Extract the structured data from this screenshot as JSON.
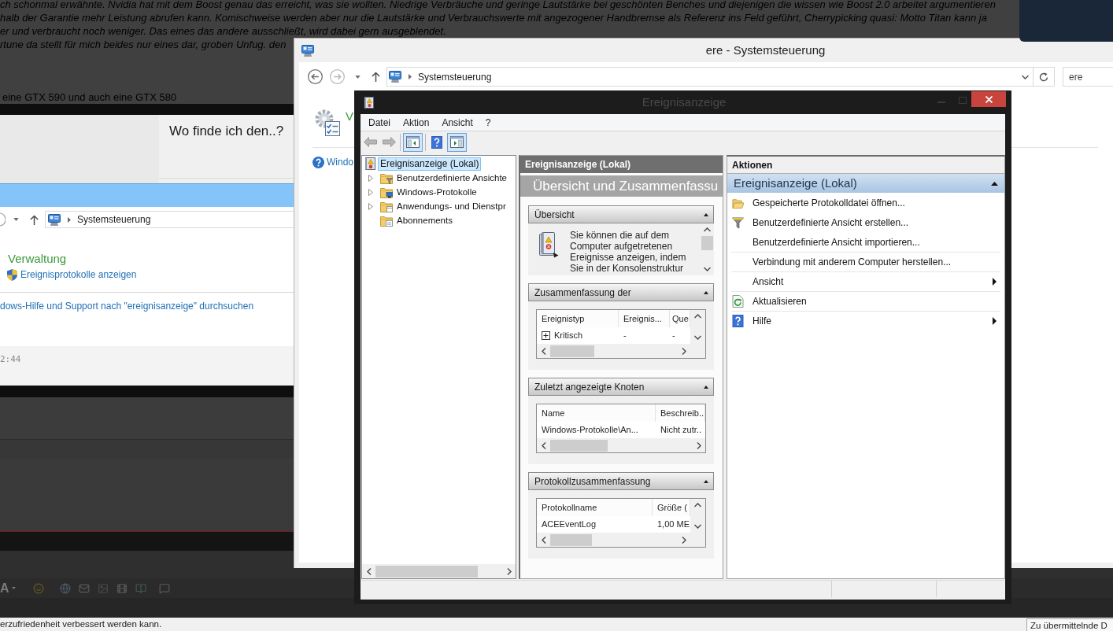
{
  "forum": {
    "post_lines": [
      "ch schonmal erwähnte. Nvidia hat mit dem Boost genau das erreicht, was sie wollten. Niedrige Verbräuche und geringe Lautstärke bei geschönten Benches und diejenigen die wissen wie Boost 2.0 arbeitet argumentieren",
      "halb der Garantie mehr Leistung abrufen kann. Komischweise werden aber nur die Lautstärke und Verbrauchswerte mit angezogener Handbremse als Referenz ins Feld geführt, Cherrypicking quasi: Motto Titan kann ja",
      "er und verbraucht noch weniger. Das eines das andere ausschließt, wird dabei gern ausgeblendet.",
      "rtune da stellt für mich beides nur eines dar, groben Unfug. den"
    ],
    "gtx_line": "eine GTX 590 und auch eine GTX 580"
  },
  "forum_screenshot": {
    "question": "Wo finde ich den..?",
    "breadcrumb": "Systemsteuerung",
    "result_title": "Verwaltung",
    "result_link": "Ereignisprotokolle anzeigen",
    "help_link": "dows-Hilfe und Support nach \"ereignisanzeige\" durchsuchen",
    "timestamp": "2:44"
  },
  "editor_toolbar": {
    "font_button": "A"
  },
  "notice_bar": {
    "text": "erzufriedenheit verbessert werden kann.",
    "button": "Zu übermittelnde D"
  },
  "control_panel_window": {
    "title": "ere - Systemsteuerung",
    "breadcrumb": "Systemsteuerung",
    "search_value": "ere",
    "result_title": "V",
    "help_link": "Windo"
  },
  "event_viewer": {
    "title": "Ereignisanzeige",
    "menu": [
      "Datei",
      "Aktion",
      "Ansicht",
      "?"
    ],
    "toolbar": [
      {
        "kind": "back",
        "disabled": true,
        "pressed": false
      },
      {
        "kind": "forward",
        "disabled": true,
        "pressed": false
      },
      {
        "kind": "console-tree",
        "disabled": false,
        "pressed": true
      },
      {
        "kind": "help",
        "disabled": false,
        "pressed": false
      },
      {
        "kind": "action-pane",
        "disabled": false,
        "pressed": true
      }
    ],
    "tree": [
      {
        "label": "Ereignisanzeige (Lokal)",
        "selected": true,
        "children": [
          {
            "kind": "custom-views",
            "label": "Benutzerdefinierte Ansichte",
            "selected": false,
            "expandable": true
          },
          {
            "kind": "windows-logs",
            "label": "Windows-Protokolle",
            "selected": false,
            "expandable": true
          },
          {
            "kind": "app-logs",
            "label": "Anwendungs- und Dienstpr",
            "selected": false,
            "expandable": true
          },
          {
            "kind": "subscriptions",
            "label": "Abonnements",
            "selected": false,
            "expandable": false
          }
        ]
      }
    ],
    "center": {
      "header": "Ereignisanzeige (Lokal)",
      "banner": "Übersicht und Zusammenfassu",
      "sections": [
        {
          "kind": "text",
          "title": "Übersicht",
          "expanded": true,
          "text": "Sie können die auf dem Computer aufgetretenen Ereignisse anzeigen, indem Sie in der Konsolenstruktur"
        },
        {
          "kind": "table",
          "title": "Zusammenfassung der",
          "expanded": true,
          "columns": [
            "Ereignistyp",
            "Ereignis...",
            "Que"
          ],
          "rows": [
            {
              "expandable": true,
              "cells": [
                "Kritisch",
                "-",
                "-"
              ]
            }
          ]
        },
        {
          "kind": "table",
          "title": "Zuletzt angezeigte Knoten",
          "expanded": true,
          "columns": [
            "Name",
            "Beschreib.."
          ],
          "rows": [
            {
              "expandable": false,
              "cells": [
                "Windows-Protokolle\\An...",
                "Nicht zutr.."
              ]
            }
          ]
        },
        {
          "kind": "table",
          "title": "Protokollzusammenfassung",
          "expanded": true,
          "columns": [
            "Protokollname",
            "Größe ("
          ],
          "rows": [
            {
              "expandable": false,
              "cells": [
                "ACEEventLog",
                "1,00 ME"
              ]
            }
          ]
        }
      ]
    },
    "actions": {
      "title": "Aktionen",
      "group": "Ereignisanzeige (Lokal)",
      "expanded": true,
      "items": [
        {
          "kind": "open-log",
          "label": "Gespeicherte Protokolldatei öffnen...",
          "submenu": false
        },
        {
          "kind": "create-view",
          "label": "Benutzerdefinierte Ansicht erstellen...",
          "submenu": false
        },
        {
          "kind": "import-view",
          "label": "Benutzerdefinierte Ansicht importieren...",
          "submenu": false
        },
        {
          "kind": "connect",
          "label": "Verbindung mit anderem Computer herstellen...",
          "submenu": false
        },
        {
          "kind": "view",
          "label": "Ansicht",
          "submenu": true
        },
        {
          "kind": "refresh",
          "label": "Aktualisieren",
          "submenu": false
        },
        {
          "kind": "help",
          "label": "Hilfe",
          "submenu": true
        }
      ]
    }
  }
}
